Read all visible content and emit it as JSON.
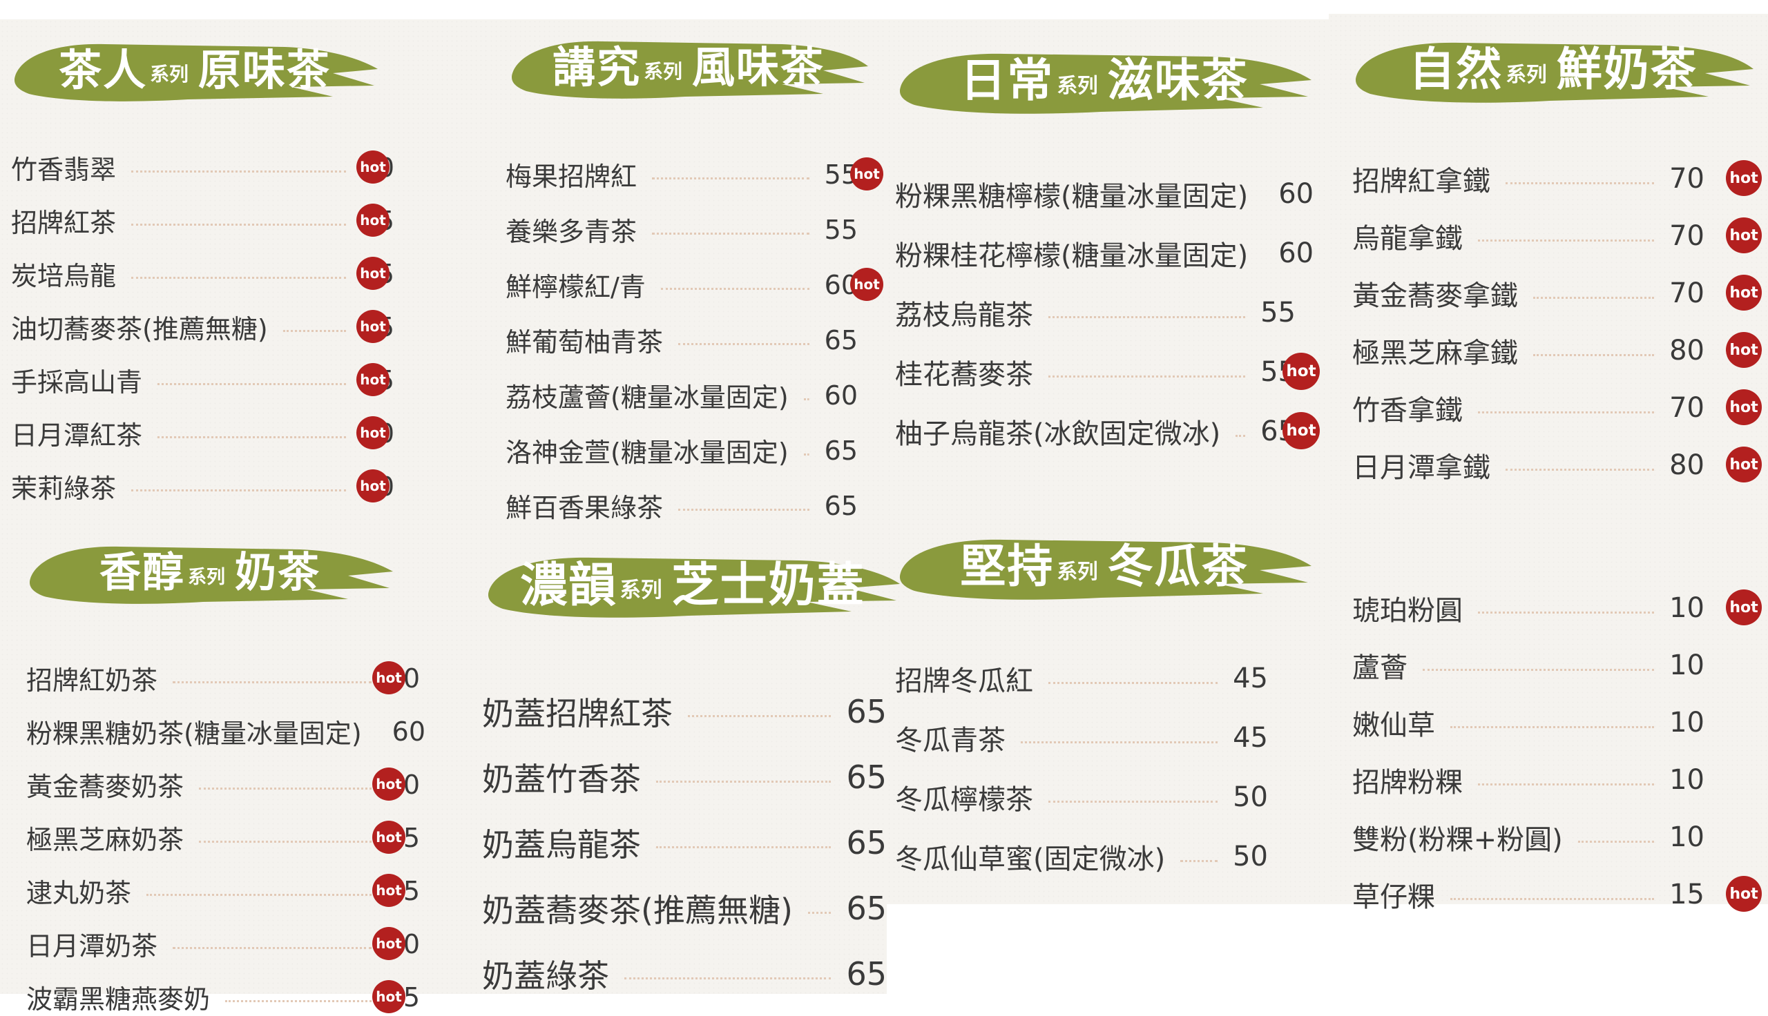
{
  "colors": {
    "banner": "#8a9a3d",
    "hot": "#b3201f",
    "panel": "#f5f3ef",
    "text": "#3a3a3a",
    "dots": "#e2c9b6"
  },
  "badge_icon": "hot-stamp-icon",
  "sections": {
    "s1": {
      "main": "茶人",
      "series": "系列",
      "sub": "原味茶",
      "items": [
        {
          "name": "竹香翡翠",
          "price": "40",
          "hot": true
        },
        {
          "name": "招牌紅茶",
          "price": "35",
          "hot": true
        },
        {
          "name": "炭培烏龍",
          "price": "35",
          "hot": true
        },
        {
          "name": "油切蕎麥茶(推薦無糖)",
          "price": "35",
          "hot": true
        },
        {
          "name": "手採高山青",
          "price": "35",
          "hot": true
        },
        {
          "name": "日月潭紅茶",
          "price": "40",
          "hot": true
        },
        {
          "name": "茉莉綠茶",
          "price": "30",
          "hot": true
        }
      ]
    },
    "s2": {
      "main": "講究",
      "series": "系列",
      "sub": "風味茶",
      "items": [
        {
          "name": "梅果招牌紅",
          "price": "55",
          "hot": true
        },
        {
          "name": "養樂多青茶",
          "price": "55",
          "hot": false
        },
        {
          "name": "鮮檸檬紅/青",
          "price": "60",
          "hot": true
        },
        {
          "name": "鮮葡萄柚青茶",
          "price": "65",
          "hot": false
        },
        {
          "name": "荔枝蘆薈(糖量冰量固定)",
          "price": "60",
          "hot": false
        },
        {
          "name": "洛神金萱(糖量冰量固定)",
          "price": "65",
          "hot": false
        },
        {
          "name": "鮮百香果綠茶",
          "price": "65",
          "hot": false
        }
      ]
    },
    "s3": {
      "main": "日常",
      "series": "系列",
      "sub": "滋味茶",
      "items": [
        {
          "name": "粉粿黑糖檸檬(糖量冰量固定)",
          "price": "60",
          "hot": false
        },
        {
          "name": "粉粿桂花檸檬(糖量冰量固定)",
          "price": "60",
          "hot": false
        },
        {
          "name": "荔枝烏龍茶",
          "price": "55",
          "hot": false
        },
        {
          "name": "桂花蕎麥茶",
          "price": "55",
          "hot": true
        },
        {
          "name": "柚子烏龍茶(冰飲固定微冰)",
          "price": "65",
          "hot": true
        }
      ]
    },
    "s4": {
      "main": "自然",
      "series": "系列",
      "sub": "鮮奶茶",
      "items": [
        {
          "name": "招牌紅拿鐵",
          "price": "70",
          "hot": true
        },
        {
          "name": "烏龍拿鐵",
          "price": "70",
          "hot": true
        },
        {
          "name": "黃金蕎麥拿鐵",
          "price": "70",
          "hot": true
        },
        {
          "name": "極黑芝麻拿鐵",
          "price": "80",
          "hot": true
        },
        {
          "name": "竹香拿鐵",
          "price": "70",
          "hot": true
        },
        {
          "name": "日月潭拿鐵",
          "price": "80",
          "hot": true
        }
      ]
    },
    "s5": {
      "main": "香醇",
      "series": "系列",
      "sub": "奶茶",
      "items": [
        {
          "name": "招牌紅奶茶",
          "price": "50",
          "hot": true
        },
        {
          "name": "粉粿黑糖奶茶(糖量冰量固定)",
          "price": "60",
          "hot": false
        },
        {
          "name": "黃金蕎麥奶茶",
          "price": "50",
          "hot": true
        },
        {
          "name": "極黑芝麻奶茶",
          "price": "65",
          "hot": true
        },
        {
          "name": "逮丸奶茶",
          "price": "65",
          "hot": true
        },
        {
          "name": "日月潭奶茶",
          "price": "60",
          "hot": true
        },
        {
          "name": "波霸黑糖燕麥奶",
          "price": "65",
          "hot": true
        }
      ]
    },
    "s6": {
      "main": "濃韻",
      "series": "系列",
      "sub": "芝士奶蓋",
      "items": [
        {
          "name": "奶蓋招牌紅茶",
          "price": "65",
          "hot": false
        },
        {
          "name": "奶蓋竹香茶",
          "price": "65",
          "hot": false
        },
        {
          "name": "奶蓋烏龍茶",
          "price": "65",
          "hot": false
        },
        {
          "name": "奶蓋蕎麥茶(推薦無糖)",
          "price": "65",
          "hot": false
        },
        {
          "name": "奶蓋綠茶",
          "price": "65",
          "hot": false
        }
      ]
    },
    "s7": {
      "main": "堅持",
      "series": "系列",
      "sub": "冬瓜茶",
      "items": [
        {
          "name": "招牌冬瓜紅",
          "price": "45",
          "hot": false
        },
        {
          "name": "冬瓜青茶",
          "price": "45",
          "hot": false
        },
        {
          "name": "冬瓜檸檬茶",
          "price": "50",
          "hot": false
        },
        {
          "name": "冬瓜仙草蜜(固定微冰)",
          "price": "50",
          "hot": false
        }
      ]
    },
    "s8": {
      "items": [
        {
          "name": "琥珀粉圓",
          "price": "10",
          "hot": true
        },
        {
          "name": "蘆薈",
          "price": "10",
          "hot": false
        },
        {
          "name": "嫩仙草",
          "price": "10",
          "hot": false
        },
        {
          "name": "招牌粉粿",
          "price": "10",
          "hot": false
        },
        {
          "name": "雙粉(粉粿+粉圓)",
          "price": "10",
          "hot": false
        },
        {
          "name": "草仔粿",
          "price": "15",
          "hot": true
        }
      ]
    }
  }
}
